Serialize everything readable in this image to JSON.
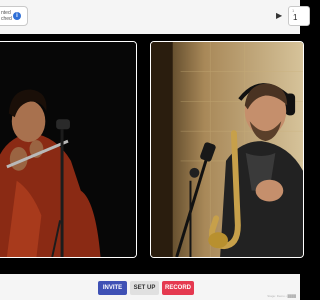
{
  "status": {
    "line1": "nted",
    "line2": "ched"
  },
  "counter": {
    "small_label": "1",
    "value": "1"
  },
  "controls": {
    "invite_label": "INVITE",
    "setup_label": "SET UP",
    "record_label": "RECORD"
  },
  "footer": {
    "note": "Stage: Demo • ████"
  },
  "colors": {
    "invite": "#3f51b5",
    "setup": "#e0e0e0",
    "record": "#e53950"
  }
}
